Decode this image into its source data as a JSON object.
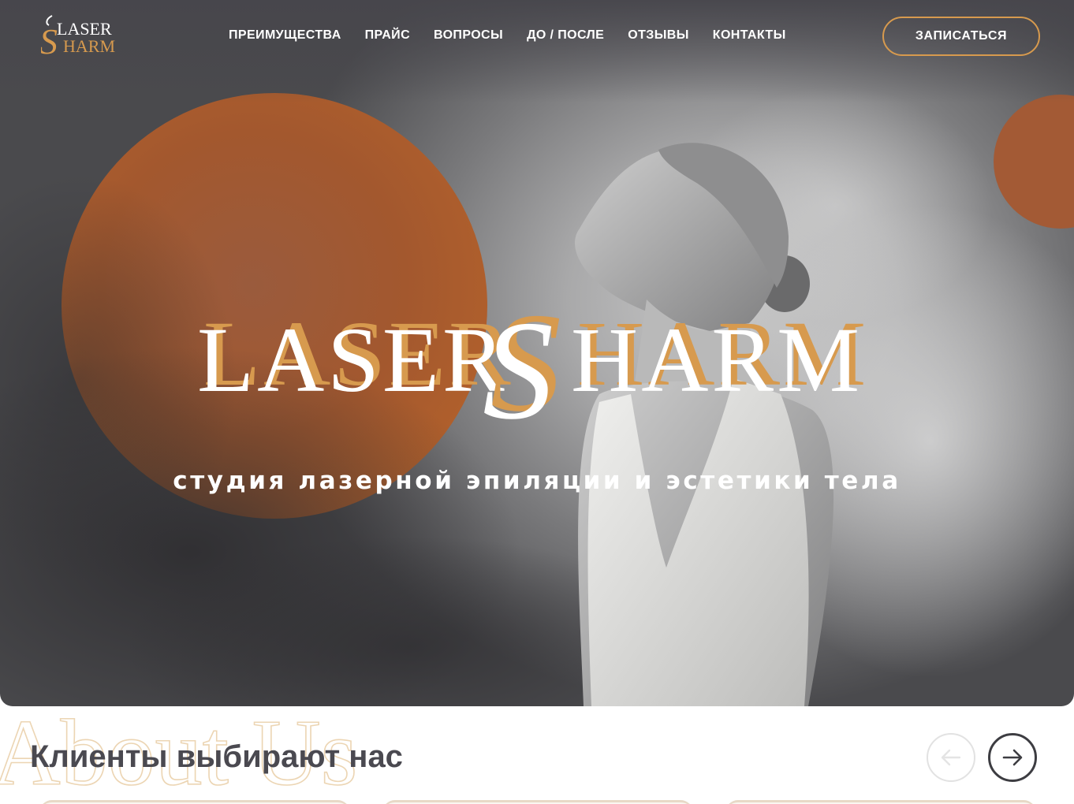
{
  "brand": {
    "name": "LASERSHARM",
    "small_logo_line1": "LASER",
    "small_logo_line2": "HARM",
    "big_logo_left": "LASER",
    "big_logo_s": "S",
    "big_logo_right": "HARM",
    "tagline": "студия лазерной эпиляции и эстетики тела"
  },
  "nav": {
    "items": [
      {
        "label": "ПРЕИМУЩЕСТВА"
      },
      {
        "label": "ПРАЙС"
      },
      {
        "label": "ВОПРОСЫ"
      },
      {
        "label": "ДО / ПОСЛЕ"
      },
      {
        "label": "ОТЗЫВЫ"
      },
      {
        "label": "КОНТАКТЫ"
      }
    ],
    "cta_label": "ЗАПИСАТЬСЯ"
  },
  "reviews": {
    "bg_word": "About Us",
    "title": "Клиенты выбирают нас",
    "prev_icon": "arrow-left-icon",
    "next_icon": "arrow-right-icon"
  },
  "colors": {
    "accent": "#d79a4e",
    "orange_circle": "#a9552b",
    "text_dark": "#4a4950",
    "white": "#ffffff"
  }
}
